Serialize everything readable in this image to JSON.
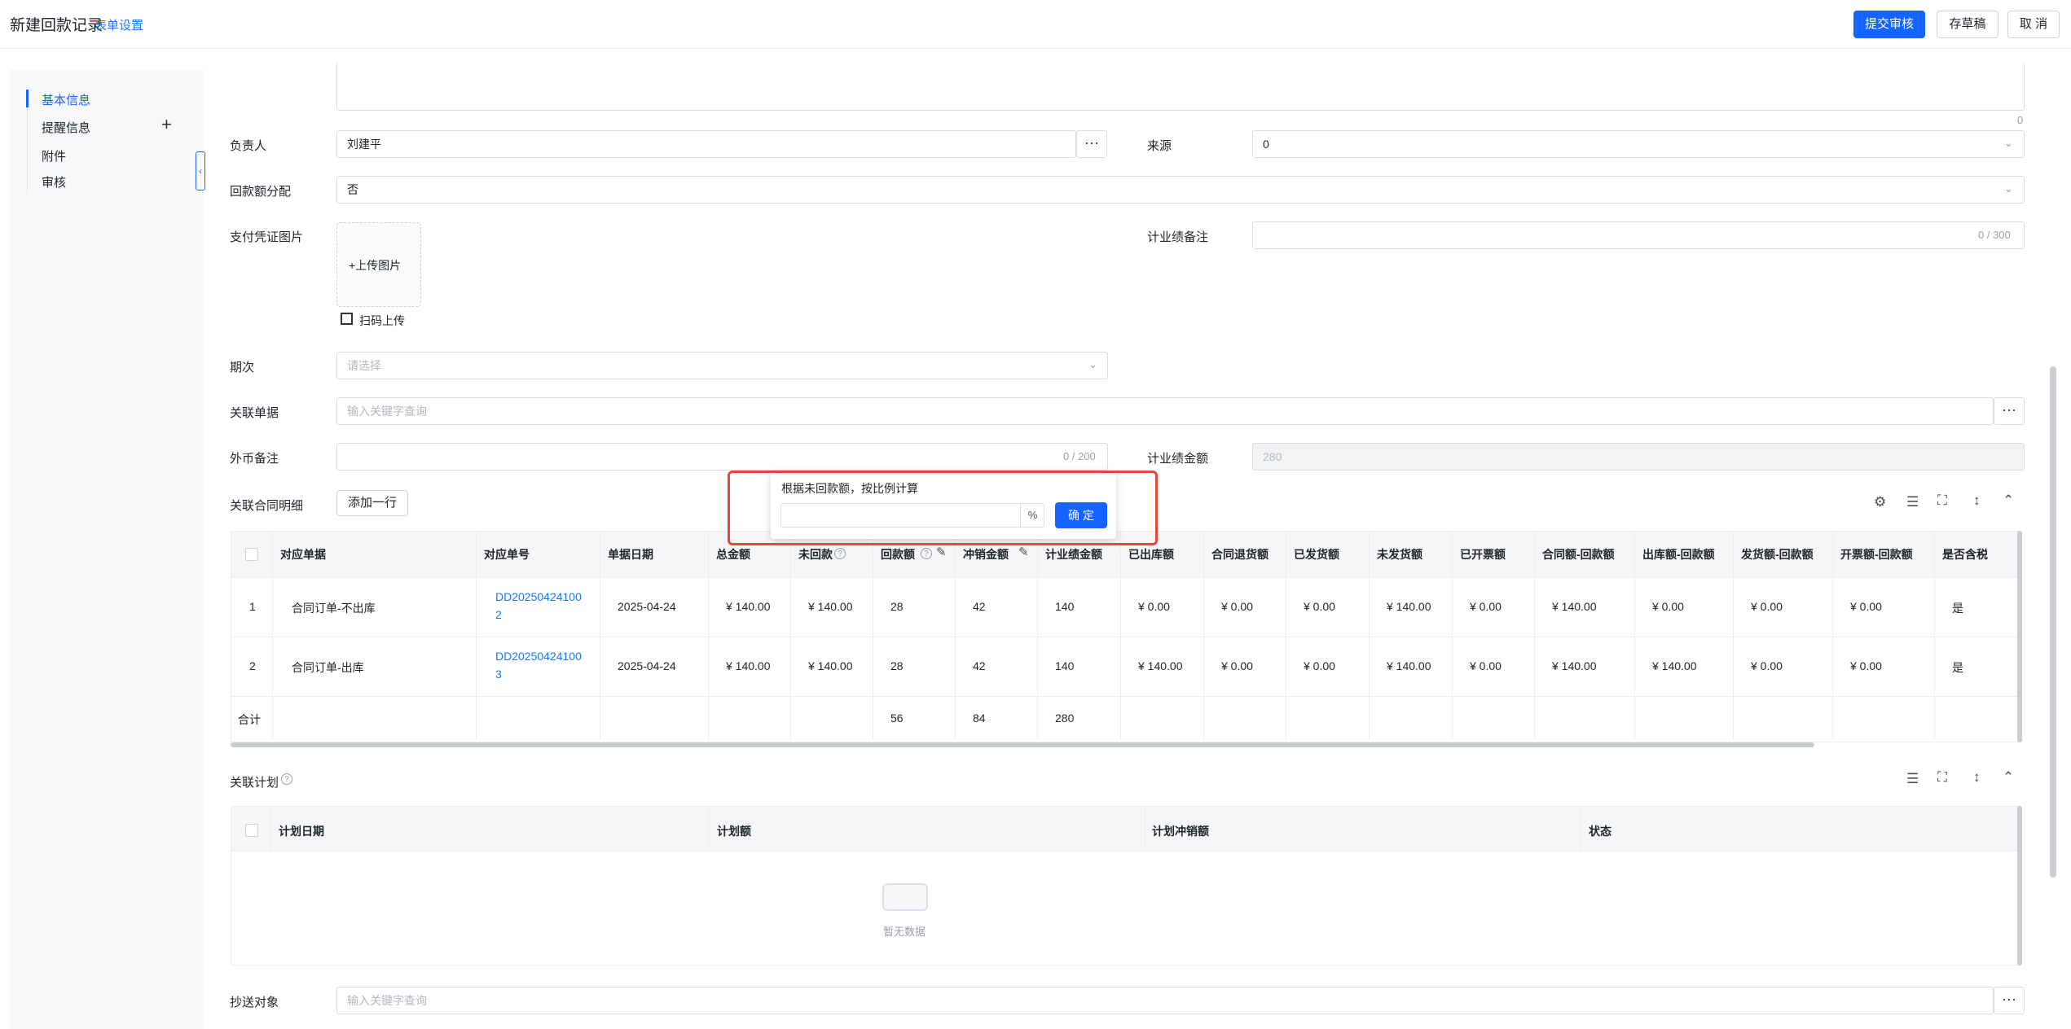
{
  "header": {
    "title": "新建回款记录",
    "form_settings": "表单设置",
    "submit": "提交审核",
    "save_draft": "存草稿",
    "cancel": "取 消"
  },
  "sidebar": {
    "items": [
      {
        "label": "基本信息",
        "active": true
      },
      {
        "label": "提醒信息",
        "add": "+"
      },
      {
        "label": "附件"
      },
      {
        "label": "审核"
      }
    ],
    "collapse_glyph": "‹"
  },
  "form": {
    "textarea_counter": "0",
    "owner_label": "负责人",
    "owner_value": "刘建平",
    "dots": "···",
    "source_label": "来源",
    "source_value": "0",
    "allocation_label": "回款额分配",
    "allocation_value": "否",
    "proof_label": "支付凭证图片",
    "upload_label": "+上传图片",
    "scan_upload": "扫码上传",
    "perf_note_label": "计业绩备注",
    "perf_note_counter": "0 / 300",
    "period_label": "期次",
    "period_placeholder": "请选择",
    "related_doc_label": "关联单据",
    "related_doc_placeholder": "输入关键字查询",
    "fx_note_label": "外币备注",
    "fx_note_counter": "0 / 200",
    "perf_amount_label": "计业绩金额",
    "perf_amount_value": "280",
    "cc_label": "抄送对象",
    "cc_placeholder": "输入关键字查询"
  },
  "popup": {
    "title": "根据未回款额，按比例计算",
    "unit": "%",
    "confirm": "确 定"
  },
  "contract_section": {
    "title": "关联合同明细",
    "add_row": "添加一行",
    "columns": [
      "对应单据",
      "对应单号",
      "单据日期",
      "总金额",
      "未回款",
      "回款额",
      "冲销金额",
      "计业绩金额",
      "已出库额",
      "合同退货额",
      "已发货额",
      "未发货额",
      "已开票额",
      "合同额-回款额",
      "出库额-回款额",
      "发货额-回款额",
      "开票额-回款额",
      "是否含税"
    ],
    "rows": [
      {
        "idx": "1",
        "doc": "合同订单-不出库",
        "no_line1": "DD20250424100",
        "no_line2": "2",
        "date": "2025-04-24",
        "total": "¥ 140.00",
        "unpaid": "¥ 140.00",
        "paid": "28",
        "writeoff": "42",
        "perf": "140",
        "shipped_out": "¥ 0.00",
        "returned": "¥ 0.00",
        "delivered": "¥ 0.00",
        "undelivered": "¥ 140.00",
        "invoiced": "¥ 0.00",
        "contract_minus": "¥ 140.00",
        "out_minus": "¥ 0.00",
        "deliver_minus": "¥ 0.00",
        "invoice_minus": "¥ 0.00",
        "tax": "是"
      },
      {
        "idx": "2",
        "doc": "合同订单-出库",
        "no_line1": "DD20250424100",
        "no_line2": "3",
        "date": "2025-04-24",
        "total": "¥ 140.00",
        "unpaid": "¥ 140.00",
        "paid": "28",
        "writeoff": "42",
        "perf": "140",
        "shipped_out": "¥ 140.00",
        "returned": "¥ 0.00",
        "delivered": "¥ 0.00",
        "undelivered": "¥ 140.00",
        "invoiced": "¥ 0.00",
        "contract_minus": "¥ 140.00",
        "out_minus": "¥ 140.00",
        "deliver_minus": "¥ 0.00",
        "invoice_minus": "¥ 0.00",
        "tax": "是"
      }
    ],
    "total_label": "合计",
    "totals": {
      "paid": "56",
      "writeoff": "84",
      "perf": "280"
    }
  },
  "plan_section": {
    "title": "关联计划",
    "columns": [
      "计划日期",
      "计划额",
      "计划冲销额",
      "状态"
    ],
    "empty": "暂无数据"
  },
  "colors": {
    "primary": "#1664ff",
    "highlight": "#e8463c"
  }
}
